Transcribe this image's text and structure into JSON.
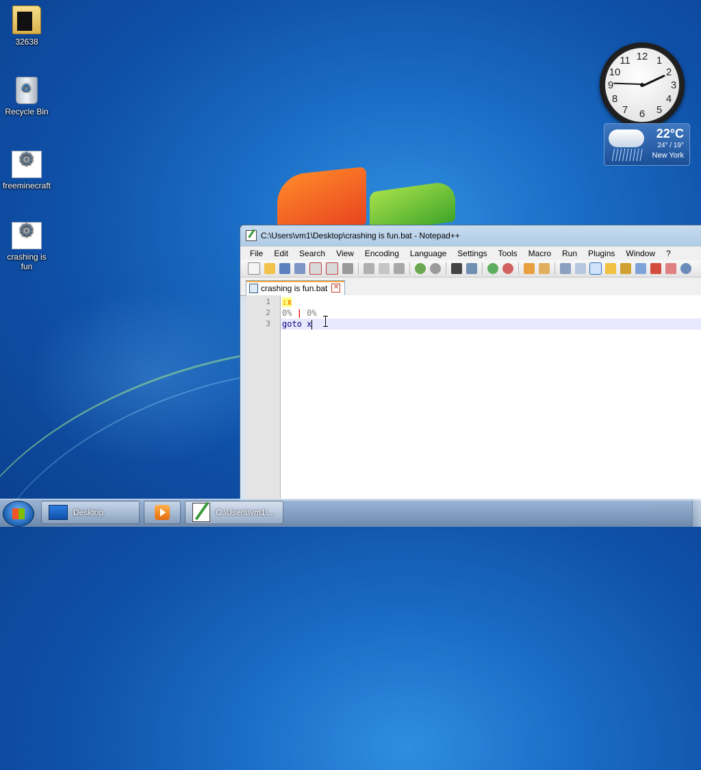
{
  "desktop": {
    "icons": [
      {
        "label": "32638",
        "type": "folder"
      },
      {
        "label": "Recycle Bin",
        "type": "recycle-bin"
      },
      {
        "label": "freeminecraft",
        "type": "batch-file"
      },
      {
        "label": "crashing is fun",
        "type": "batch-file"
      }
    ]
  },
  "clock_gadget": {
    "numbers": [
      "12",
      "1",
      "2",
      "3",
      "4",
      "5",
      "6",
      "7",
      "8",
      "9",
      "10",
      "11"
    ]
  },
  "weather_gadget": {
    "temperature": "22°C",
    "range": "24° / 19°",
    "city": "New York",
    "condition_icon": "rain-cloud-icon"
  },
  "notepad": {
    "title": "C:\\Users\\vm1\\Desktop\\crashing is fun.bat - Notepad++",
    "menu": [
      "File",
      "Edit",
      "Search",
      "View",
      "Encoding",
      "Language",
      "Settings",
      "Tools",
      "Macro",
      "Run",
      "Plugins",
      "Window",
      "?"
    ],
    "toolbar_icons": [
      "new-file-icon",
      "open-file-icon",
      "save-icon",
      "save-all-icon",
      "close-icon",
      "close-all-icon",
      "print-icon",
      "cut-icon",
      "copy-icon",
      "paste-icon",
      "undo-icon",
      "redo-icon",
      "find-icon",
      "replace-icon",
      "zoom-in-icon",
      "zoom-out-icon",
      "sync-vertical-icon",
      "sync-horizontal-icon",
      "word-wrap-icon",
      "show-all-chars-icon",
      "indent-guide-icon",
      "user-language-icon",
      "document-map-icon",
      "function-list-icon",
      "folder-workspace-icon",
      "monitor-icon",
      "record-macro-icon",
      "view-icon"
    ],
    "tab": {
      "label": "crashing is fun.bat",
      "close_glyph": "✕"
    },
    "lines": [
      {
        "number": "1",
        "label": ":x"
      },
      {
        "number": "2",
        "part1": "0%",
        "pipe": "|",
        "part2": "0%"
      },
      {
        "number": "3",
        "keyword": "goto",
        "arg": "x"
      }
    ]
  },
  "taskbar": {
    "items": [
      {
        "label": "Desktop",
        "icon": "desktop-icon"
      },
      {
        "label": "",
        "icon": "media-player-icon"
      },
      {
        "label": "C:\\Users\\vm1\\...",
        "icon": "notepadpp-icon"
      }
    ]
  },
  "colors": {
    "wallpaper": "#1a6cc4",
    "label_highlight": "#ffff80",
    "label_text": "#ff8000",
    "operator": "#ff0000",
    "keyword": "#000080"
  }
}
